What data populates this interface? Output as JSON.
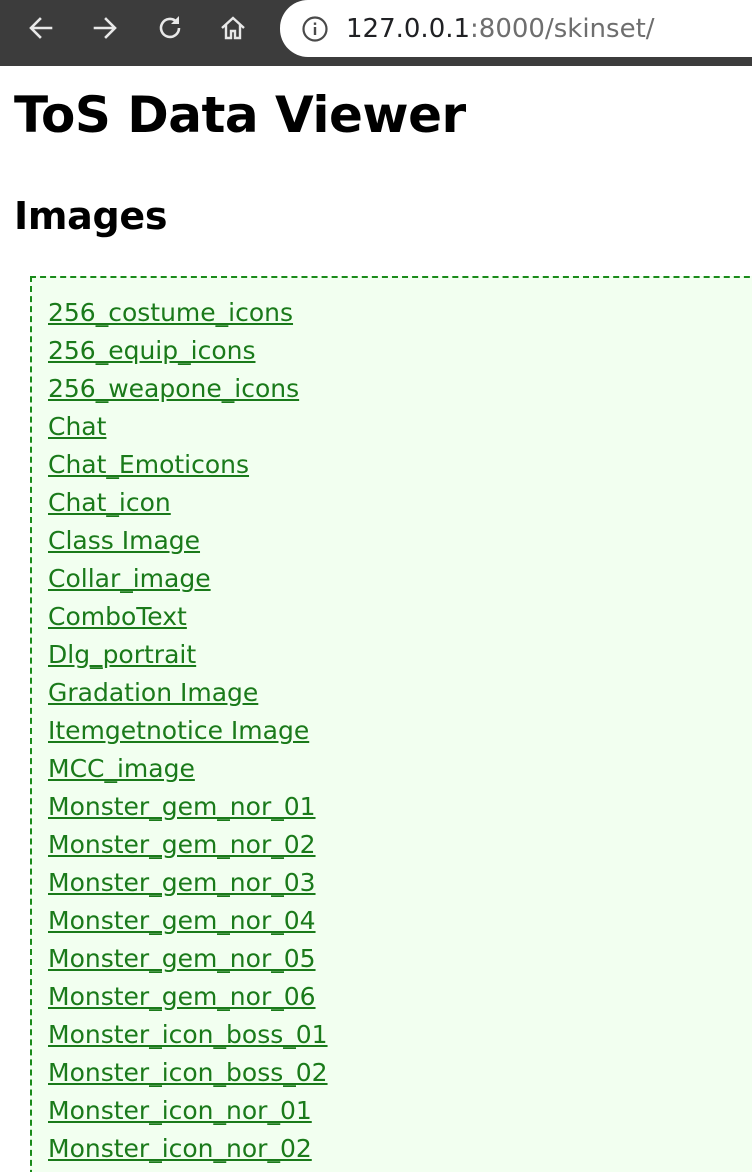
{
  "browser": {
    "url_host": "127.0.0.1",
    "url_port_path": ":8000/skinset/"
  },
  "page": {
    "title": "ToS Data Viewer",
    "section_title": "Images"
  },
  "links": [
    "256_costume_icons",
    "256_equip_icons",
    "256_weapone_icons",
    "Chat",
    "Chat_Emoticons",
    "Chat_icon",
    "Class Image",
    "Collar_image",
    "ComboText",
    "Dlg_portrait",
    "Gradation Image",
    "Itemgetnotice Image",
    "MCC_image",
    "Monster_gem_nor_01",
    "Monster_gem_nor_02",
    "Monster_gem_nor_03",
    "Monster_gem_nor_04",
    "Monster_gem_nor_05",
    "Monster_gem_nor_06",
    "Monster_icon_boss_01",
    "Monster_icon_boss_02",
    "Monster_icon_nor_01",
    "Monster_icon_nor_02"
  ],
  "colors": {
    "toolbar": "#3c3c3c",
    "link": "#1a7a1a",
    "list_border": "#1a8a1a",
    "list_background": "#f2fff0"
  },
  "icons": [
    "back-arrow-icon",
    "forward-arrow-icon",
    "reload-icon",
    "home-icon",
    "info-icon"
  ]
}
